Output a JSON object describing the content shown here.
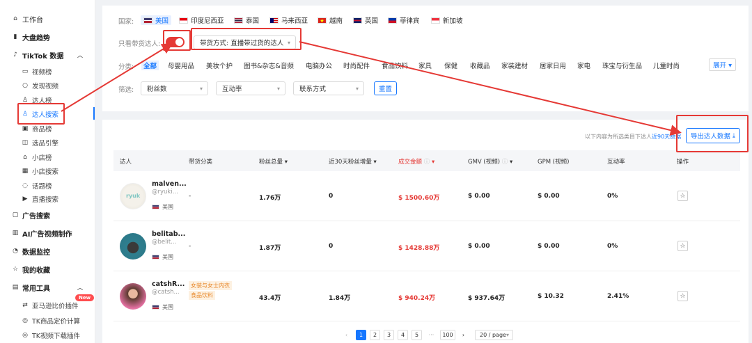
{
  "sidebar": {
    "workbench": "工作台",
    "market_trends": "大盘趋势",
    "tiktok_data": "TikTok 数据",
    "video_rank": "视频榜",
    "discover_videos": "发现视频",
    "creator_rank": "达人榜",
    "creator_search": "达人搜索",
    "product_rank": "商品榜",
    "product_engine": "选品引擎",
    "shop_rank": "小店榜",
    "shop_search": "小店搜索",
    "topic_rank": "话题榜",
    "live_search": "直播搜索",
    "ad_search": "广告搜索",
    "ai_ad_video": "AI广告视频制作",
    "data_monitor": "数据监控",
    "my_favorites": "我的收藏",
    "common_tools": "常用工具",
    "amazon_plugin": "亚马逊比价插件",
    "new_badge": "New",
    "tk_pricing": "TK商品定价计算",
    "tk_video_dl": "TK视频下载插件"
  },
  "filters": {
    "country_label": "国家:",
    "countries": [
      "美国",
      "印度尼西亚",
      "泰国",
      "马来西亚",
      "越南",
      "英国",
      "菲律宾",
      "新加坡"
    ],
    "only_selling_label": "只看带货达人:",
    "selling_method": "带货方式: 直播带过货的达人",
    "category_label": "分类:",
    "categories": [
      "全部",
      "母婴用品",
      "美妆个护",
      "图书&杂志&音频",
      "电脑办公",
      "时尚配件",
      "食品饮料",
      "家具",
      "保健",
      "收藏品",
      "家装建材",
      "居家日用",
      "家电",
      "珠宝与衍生品",
      "儿童时尚"
    ],
    "expand": "展开",
    "filter_label": "筛选:",
    "followers": "粉丝数",
    "engagement": "互动率",
    "contact": "联系方式",
    "reset": "重置"
  },
  "table": {
    "hint_prefix": "以下内容为所选类目下达人",
    "hint_link": "近90天数据",
    "export": "导出达人数据",
    "headers": {
      "creator": "达人",
      "category": "带货分类",
      "followers": "粉丝总量",
      "followers_30d": "近30天粉丝增量",
      "gmv_amount": "成交金额",
      "gmv_video": "GMV (视频)",
      "gpm_video": "GPM (视频)",
      "engagement": "互动率",
      "action": "操作"
    },
    "rows": [
      {
        "name": "malven...",
        "handle": "@ryuki...",
        "country": "美国",
        "category": "-",
        "followers": "1.76万",
        "followers_30d": "0",
        "amount": "$ 1500.60万",
        "gmv": "$ 0.00",
        "gpm": "$ 0.00",
        "engagement": "0%"
      },
      {
        "name": "belitab...",
        "handle": "@belit...",
        "country": "美国",
        "category": "-",
        "followers": "1.87万",
        "followers_30d": "0",
        "amount": "$ 1428.88万",
        "gmv": "$ 0.00",
        "gpm": "$ 0.00",
        "engagement": "0%"
      },
      {
        "name": "catshR...",
        "handle": "@catsh...",
        "country": "美国",
        "tag1": "女装与女士内衣",
        "tag2": "食品饮料",
        "followers": "43.4万",
        "followers_30d": "1.84万",
        "amount": "$ 940.24万",
        "gmv": "$ 937.64万",
        "gpm": "$ 10.32",
        "engagement": "2.41%"
      }
    ]
  },
  "pagination": {
    "pages": [
      "1",
      "2",
      "3",
      "4",
      "5",
      "···",
      "100"
    ],
    "page_size": "20 / page"
  },
  "colors": {
    "accent": "#1677ff",
    "highlight_red": "#e53935"
  }
}
